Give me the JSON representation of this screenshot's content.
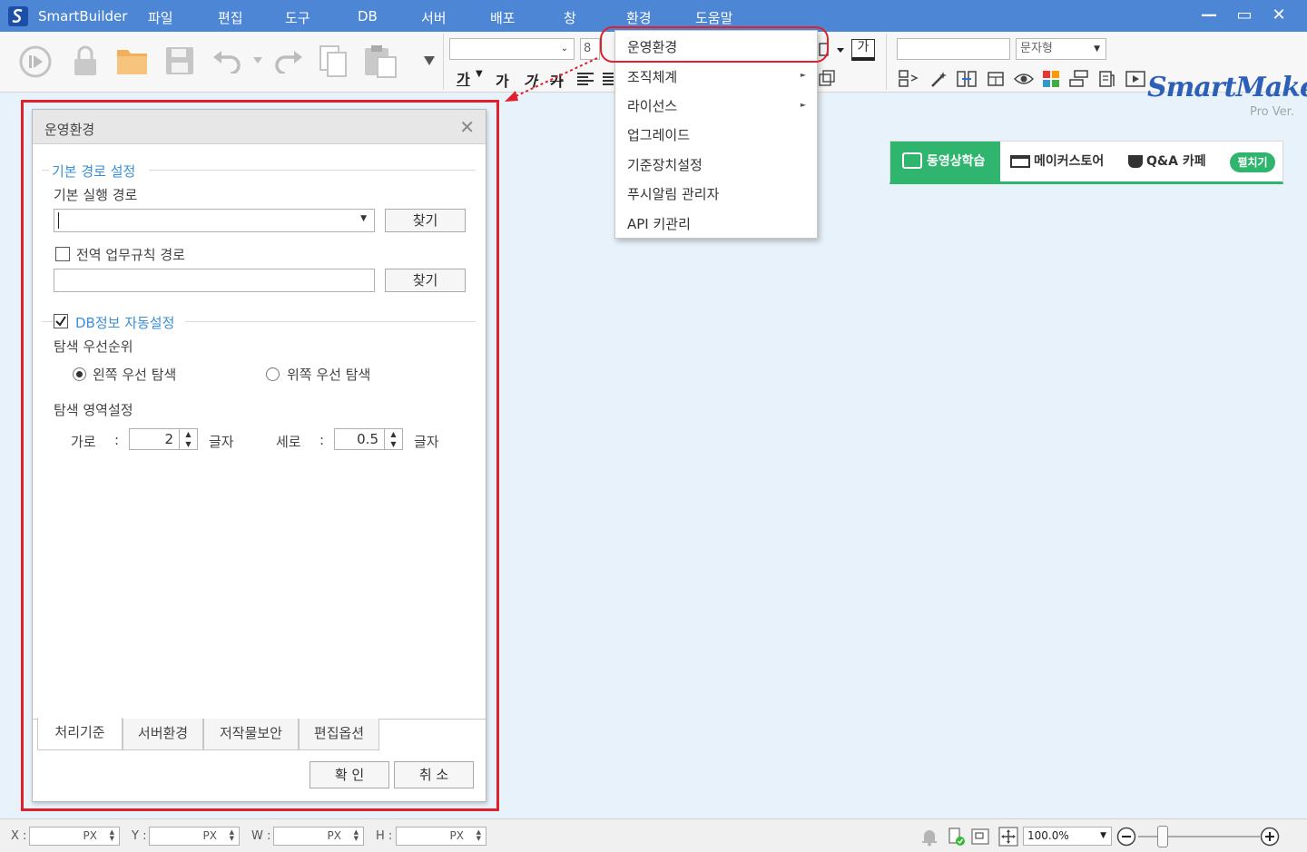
{
  "app": {
    "name": "SmartBuilder"
  },
  "menubar": [
    "파일",
    "편집",
    "도구",
    "DB",
    "서버",
    "배포",
    "창",
    "환경",
    "도움말"
  ],
  "window_controls": {
    "minimize": "—",
    "maximize": "▭",
    "close": "✕"
  },
  "toolbar": {
    "font_size": "8",
    "char_type": "문자형",
    "font_glyph_1": "가",
    "font_glyph_2": "가",
    "font_glyph_3": "가",
    "font_glyph_4": "가",
    "style_glyph": "가"
  },
  "brand": {
    "name": "SmartMaker",
    "edition": "Pro Ver."
  },
  "promo": {
    "video": "동영상학습",
    "store": "메이커스토어",
    "cafe": "Q&A 카페",
    "toggle": "펼치기"
  },
  "env_menu": {
    "items": [
      {
        "label": "운영환경",
        "submenu": false
      },
      {
        "label": "조직체계",
        "submenu": true
      },
      {
        "label": "라이선스",
        "submenu": true
      },
      {
        "label": "업그레이드",
        "submenu": false
      },
      {
        "label": "기준장치설정",
        "submenu": false
      },
      {
        "label": "푸시알림 관리자",
        "submenu": false
      },
      {
        "label": "API 키관리",
        "submenu": false
      }
    ]
  },
  "dialog": {
    "title": "운영환경",
    "close": "✕",
    "basic_path_group": "기본 경로 설정",
    "exec_path_label": "기본 실행 경로",
    "exec_path_value": "",
    "find_button": "찾기",
    "global_rule_label": "전역 업무규칙 경로",
    "global_rule_checked": false,
    "global_rule_value": "",
    "find_button_2": "찾기",
    "db_group": "DB정보 자동설정",
    "db_checked": true,
    "search_priority_label": "탐색 우선순위",
    "radio_left": "왼쪽 우선 탐색",
    "radio_top": "위쪽 우선 탐색",
    "selected_radio": "왼쪽 우선 탐색",
    "search_area_label": "탐색 영역설정",
    "width_label": "가로",
    "height_label": "세로",
    "colon": ":",
    "width_value": "2",
    "height_value": "0.5",
    "unit": "글자",
    "tabs": [
      "처리기준",
      "서버환경",
      "저작물보안",
      "편집옵션"
    ],
    "active_tab": "처리기준",
    "ok_button": "확 인",
    "cancel_button": "취 소"
  },
  "statusbar": {
    "x_label": "X :",
    "y_label": "Y :",
    "w_label": "W :",
    "h_label": "H :",
    "unit": "PX",
    "zoom": "100.0%"
  },
  "colors": {
    "titlebar": "#4c86d4",
    "highlight_red": "#e0202a",
    "accent_blue": "#3a8fd8",
    "promo_green": "#2fb56d"
  }
}
